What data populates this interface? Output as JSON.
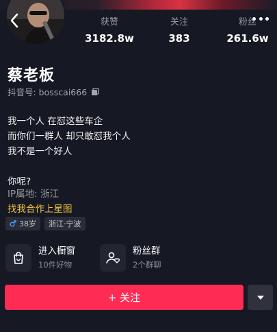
{
  "header": {
    "back_icon": "chevron-left-icon",
    "more_icon": "more-dots-icon"
  },
  "stats": [
    {
      "label": "获赞",
      "value": "3182.8w"
    },
    {
      "label": "关注",
      "value": "383"
    },
    {
      "label": "粉丝",
      "value": "261.6w"
    }
  ],
  "profile": {
    "name": "蔡老板",
    "handle": "抖音号: bosscai666",
    "bio_lines": [
      "我一个人 在怼这些车企",
      "而你们一群人 却只敢怼我个人",
      "我不是一个好人",
      "",
      "你呢?"
    ],
    "ip": "IP属地: 浙江",
    "star_link": "找我合作上星图",
    "tags": {
      "age": "38岁",
      "location": "浙江·宁波"
    }
  },
  "entries": {
    "shop": {
      "title": "进入橱窗",
      "subtitle": "10件好物"
    },
    "fans": {
      "title": "粉丝群",
      "subtitle": "2个群聊"
    }
  },
  "actions": {
    "follow_label": "+ 关注"
  },
  "colors": {
    "background": "#161823",
    "accent": "#fe2c55",
    "star": "#f0c341"
  }
}
